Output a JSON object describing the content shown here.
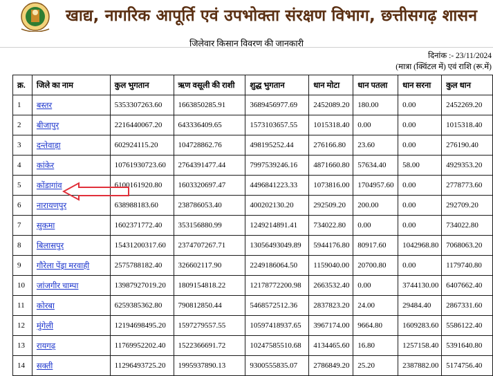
{
  "header": {
    "title": "खाद्य, नागरिक आपूर्ति एवं उपभोक्ता संरक्षण विभाग, छत्तीसगढ़ शासन",
    "emblem": "chhattisgarh-emblem",
    "emblem_text": "छत्तीसगढ़ शासन"
  },
  "page": {
    "subtitle": "जिलेवार किसान विवरण की जानकारी",
    "date": "दिनांक :- 23/11/2024",
    "units": "(मात्रा (क्विंटल में) एवं राशि (रू.में)"
  },
  "table": {
    "columns": [
      "क्र.",
      "जिले का नाम",
      "कुल भुगतान",
      "ऋण वसूली की राशी",
      "शुद्ध भुगतान",
      "धान मोटा",
      "धान पतला",
      "धान सरना",
      "कुल धान"
    ],
    "rows": [
      [
        "1",
        "बस्तर",
        "5353307263.60",
        "1663850285.91",
        "3689456977.69",
        "2452089.20",
        "180.00",
        "0.00",
        "2452269.20"
      ],
      [
        "2",
        "बीजापुर",
        "2216440067.20",
        "643336409.65",
        "1573103657.55",
        "1015318.40",
        "0.00",
        "0.00",
        "1015318.40"
      ],
      [
        "3",
        "दन्तेवाड़ा",
        "602924115.20",
        "104728862.76",
        "498195252.44",
        "276166.80",
        "23.60",
        "0.00",
        "276190.40"
      ],
      [
        "4",
        "कांकेर",
        "10761930723.60",
        "2764391477.44",
        "7997539246.16",
        "4871660.80",
        "57634.40",
        "58.00",
        "4929353.20"
      ],
      [
        "5",
        "कोंडागांव",
        "6100161920.80",
        "1603320697.47",
        "4496841223.33",
        "1073816.00",
        "1704957.60",
        "0.00",
        "2778773.60"
      ],
      [
        "6",
        "नारायणपुर",
        "638988183.60",
        "238786053.40",
        "400202130.20",
        "292509.20",
        "200.00",
        "0.00",
        "292709.20"
      ],
      [
        "7",
        "सुकमा",
        "1602371772.40",
        "353156880.99",
        "1249214891.41",
        "734022.80",
        "0.00",
        "0.00",
        "734022.80"
      ],
      [
        "8",
        "बिलासपुर",
        "15431200317.60",
        "2374707267.71",
        "13056493049.89",
        "5944176.80",
        "80917.60",
        "1042968.80",
        "7068063.20"
      ],
      [
        "9",
        "गौरेला पेंड्रा मरवाही",
        "2575788182.40",
        "326602117.90",
        "2249186064.50",
        "1159040.00",
        "20700.80",
        "0.00",
        "1179740.80"
      ],
      [
        "10",
        "जांजगीर चाम्पा",
        "13987927019.20",
        "1809154818.22",
        "12178772200.98",
        "2663532.40",
        "0.00",
        "3744130.00",
        "6407662.40"
      ],
      [
        "11",
        "कोरबा",
        "6259385362.80",
        "790812850.44",
        "5468572512.36",
        "2837823.20",
        "24.00",
        "29484.40",
        "2867331.60"
      ],
      [
        "12",
        "मुंगेली",
        "12194698495.20",
        "1597279557.55",
        "10597418937.65",
        "3967174.00",
        "9664.80",
        "1609283.60",
        "5586122.40"
      ],
      [
        "13",
        "रायगढ़",
        "11769952202.40",
        "1522366691.72",
        "10247585510.68",
        "4134465.60",
        "16.80",
        "1257158.40",
        "5391640.80"
      ],
      [
        "14",
        "सक्ती",
        "11296493725.20",
        "1995937890.13",
        "9300555835.07",
        "2786849.20",
        "25.20",
        "2387882.00",
        "5174756.40"
      ]
    ]
  },
  "colors": {
    "title": "#5a2f12",
    "link": "#1a33cc",
    "arrow": "#e0303a",
    "border": "#1a1a1a"
  }
}
